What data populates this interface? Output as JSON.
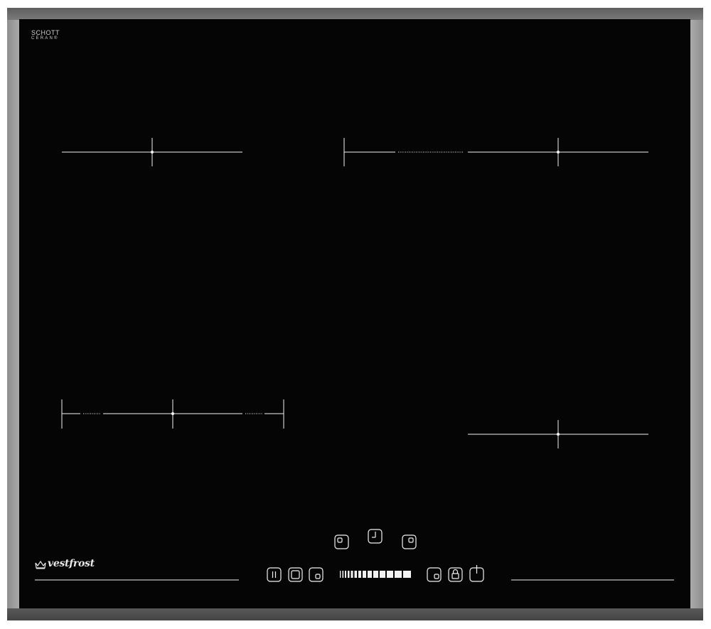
{
  "brand": {
    "glass_maker_line1": "SCHOTT",
    "glass_maker_line2": "CERAN®",
    "manufacturer": "vestfrost"
  },
  "cooking_zones": [
    {
      "name": "front-left-zone-marker",
      "type": "single"
    },
    {
      "name": "rear-right-bridge-zone-marker",
      "type": "bridge"
    },
    {
      "name": "rear-left-bridge-zone-marker",
      "type": "bridge"
    },
    {
      "name": "front-right-zone-marker",
      "type": "single"
    }
  ],
  "controls": {
    "top_row": [
      "zone-select-left-icon",
      "timer-icon",
      "zone-select-right-icon"
    ],
    "bottom_left": [
      "pause-icon",
      "bridge-zone-icon",
      "zone-select-rear-icon"
    ],
    "slider": {
      "segments": 14,
      "type": "power-slider"
    },
    "bottom_right": [
      "zone-select-front-icon",
      "lock-icon",
      "power-icon"
    ]
  },
  "colors": {
    "glass": "#050505",
    "frame": "#9b9b9b",
    "markings": "#f2f2f2"
  }
}
